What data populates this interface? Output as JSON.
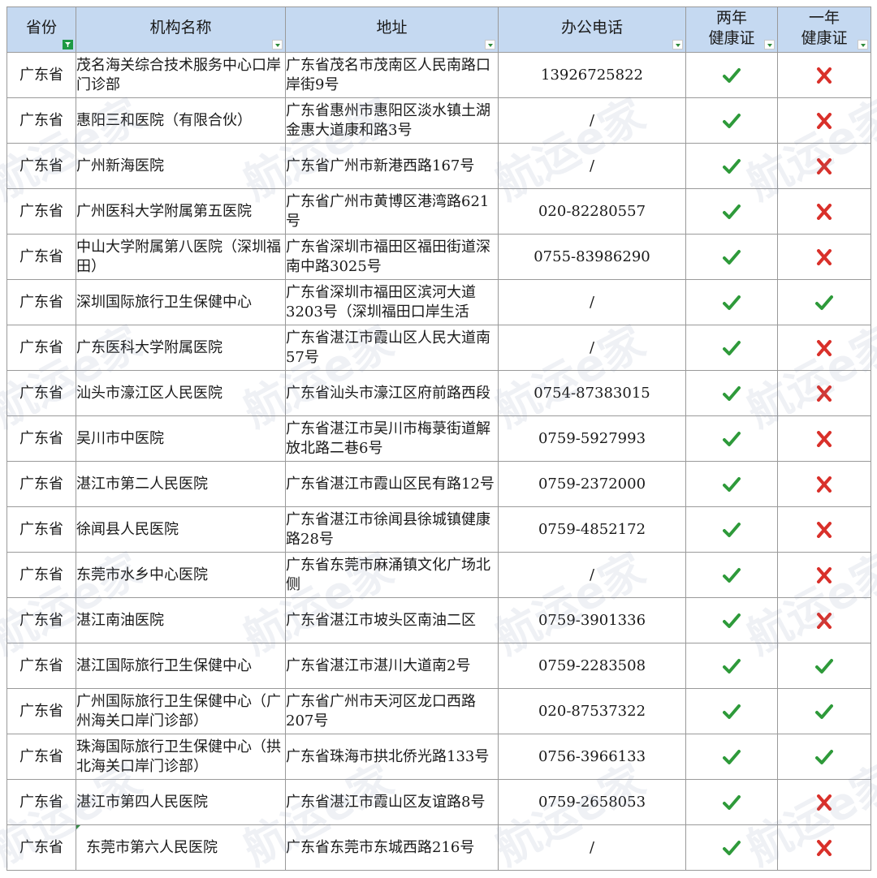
{
  "headers": {
    "province": "省份",
    "name": "机构名称",
    "address": "地址",
    "phone": "办公电话",
    "two_year": "两年\n健康证",
    "one_year": "一年\n健康证"
  },
  "watermark": "航运e家",
  "colors": {
    "header_bg": "#c5d9f1",
    "check": "#2e9a3a",
    "cross": "#d9302a"
  },
  "rows": [
    {
      "province": "广东省",
      "name": "茂名海关综合技术服务中心口岸门诊部",
      "address": "广东省茂名市茂南区人民南路口岸街9号",
      "phone": "13926725822",
      "two": "check",
      "one": "cross"
    },
    {
      "province": "广东省",
      "name": "惠阳三和医院（有限合伙）",
      "address": "广东省惠州市惠阳区淡水镇土湖金惠大道康和路3号",
      "phone": "/",
      "two": "check",
      "one": "cross"
    },
    {
      "province": "广东省",
      "name": "广州新海医院",
      "address": "广东省广州市新港西路167号",
      "phone": "/",
      "two": "check",
      "one": "cross"
    },
    {
      "province": "广东省",
      "name": "广州医科大学附属第五医院",
      "address": "广东省广州市黄博区港湾路621号",
      "phone": "020-82280557",
      "two": "check",
      "one": "cross"
    },
    {
      "province": "广东省",
      "name": "中山大学附属第八医院（深圳福田）",
      "address": "广东省深圳市福田区福田街道深南中路3025号",
      "phone": "0755-83986290",
      "two": "check",
      "one": "cross"
    },
    {
      "province": "广东省",
      "name": "深圳国际旅行卫生保健中心",
      "address": "广东省深圳市福田区滨河大道3203号（深圳福田口岸生活",
      "phone": "/",
      "two": "check",
      "one": "check"
    },
    {
      "province": "广东省",
      "name": "广东医科大学附属医院",
      "address": "广东省湛江市霞山区人民大道南57号",
      "phone": "/",
      "two": "check",
      "one": "cross"
    },
    {
      "province": "广东省",
      "name": "汕头市濠江区人民医院",
      "address": "广东省汕头市濠江区府前路西段",
      "phone": "0754-87383015",
      "two": "check",
      "one": "cross"
    },
    {
      "province": "广东省",
      "name": "吴川市中医院",
      "address": "广东省湛江市吴川市梅菉街道解放北路二巷6号",
      "phone": "0759-5927993",
      "two": "check",
      "one": "cross"
    },
    {
      "province": "广东省",
      "name": "湛江市第二人民医院",
      "address": "广东省湛江市霞山区民有路12号",
      "phone": "0759-2372000",
      "two": "check",
      "one": "cross"
    },
    {
      "province": "广东省",
      "name": "徐闻县人民医院",
      "address": "广东省湛江市徐闻县徐城镇健康路28号",
      "phone": "0759-4852172",
      "two": "check",
      "one": "cross"
    },
    {
      "province": "广东省",
      "name": "东莞市水乡中心医院",
      "address": "广东省东莞市麻涌镇文化广场北侧",
      "phone": "/",
      "two": "check",
      "one": "cross"
    },
    {
      "province": "广东省",
      "name": "湛江南油医院",
      "address": "广东省湛江市坡头区南油二区",
      "phone": "0759-3901336",
      "two": "check",
      "one": "cross"
    },
    {
      "province": "广东省",
      "name": "湛江国际旅行卫生保健中心",
      "address": "广东省湛江市湛川大道南2号",
      "phone": "0759-2283508",
      "two": "check",
      "one": "check"
    },
    {
      "province": "广东省",
      "name": "广州国际旅行卫生保健中心（广州海关口岸门诊部）",
      "address": "广东省广州市天河区龙口西路207号",
      "phone": "020-87537322",
      "two": "check",
      "one": "check"
    },
    {
      "province": "广东省",
      "name": "珠海国际旅行卫生保健中心（拱北海关口岸门诊部）",
      "address": "广东省珠海市拱北侨光路133号",
      "phone": "0756-3966133",
      "two": "check",
      "one": "check"
    },
    {
      "province": "广东省",
      "name": "湛江市第四人民医院",
      "address": "广东省湛江市霞山区友谊路8号",
      "phone": "0759-2658053",
      "two": "check",
      "one": "cross"
    },
    {
      "province": "广东省",
      "name": "东莞市第六人民医院",
      "address": "广东省东莞市东城西路216号",
      "phone": "/",
      "two": "check",
      "one": "cross"
    }
  ]
}
